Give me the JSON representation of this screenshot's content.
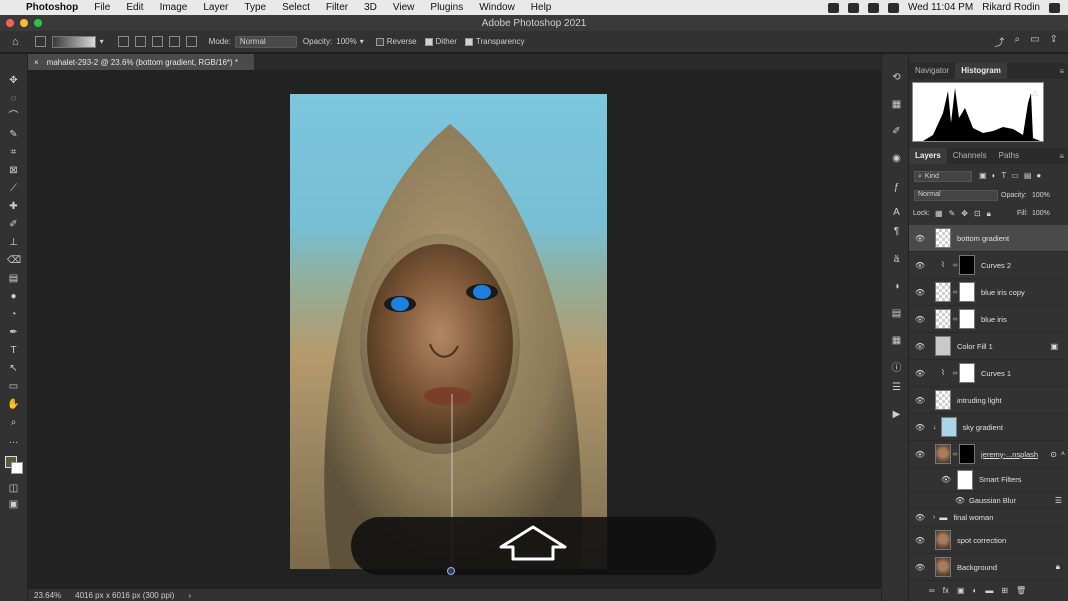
{
  "menubar": {
    "app": "Photoshop",
    "items": [
      "File",
      "Edit",
      "Image",
      "Layer",
      "Type",
      "Select",
      "Filter",
      "3D",
      "View",
      "Plugins",
      "Window",
      "Help"
    ],
    "clock": "Wed 11:04 PM",
    "user": "Rikard Rodin"
  },
  "window": {
    "title": "Adobe Photoshop 2021"
  },
  "options": {
    "mode_label": "Mode:",
    "mode_value": "Normal",
    "opacity_label": "Opacity:",
    "opacity_value": "100%",
    "reverse": "Reverse",
    "dither": "Dither",
    "transparency": "Transparency"
  },
  "document": {
    "tab_title": "mahalet-293-2 @ 23.6% (bottom gradient, RGB/16*) *"
  },
  "status": {
    "zoom": "23.64%",
    "doc_info": "4016 px x 6016 px (300 ppi)"
  },
  "panels": {
    "top_tabs": [
      "Navigator",
      "Histogram"
    ],
    "layer_tabs": [
      "Layers",
      "Channels",
      "Paths"
    ],
    "filter_kind": "Kind",
    "blend_mode": "Normal",
    "opacity_label": "Opacity:",
    "opacity_value": "100%",
    "lock_label": "Lock:",
    "fill_label": "Fill:",
    "fill_value": "100%",
    "layers": [
      {
        "name": "bottom gradient"
      },
      {
        "name": "Curves 2"
      },
      {
        "name": "blue iris copy"
      },
      {
        "name": "blue iris"
      },
      {
        "name": "Color Fill 1"
      },
      {
        "name": "Curves 1"
      },
      {
        "name": "intruding light"
      },
      {
        "name": "sky gradient"
      },
      {
        "name": "jeremy-...nsplash"
      },
      {
        "name": "Smart Filters"
      },
      {
        "name": "Gaussian Blur"
      },
      {
        "name": "final woman"
      },
      {
        "name": "spot correction"
      },
      {
        "name": "Background"
      }
    ]
  },
  "colors": {
    "accent": "#4a90d9",
    "ui_dark": "#323232",
    "canvas": "#222222"
  }
}
